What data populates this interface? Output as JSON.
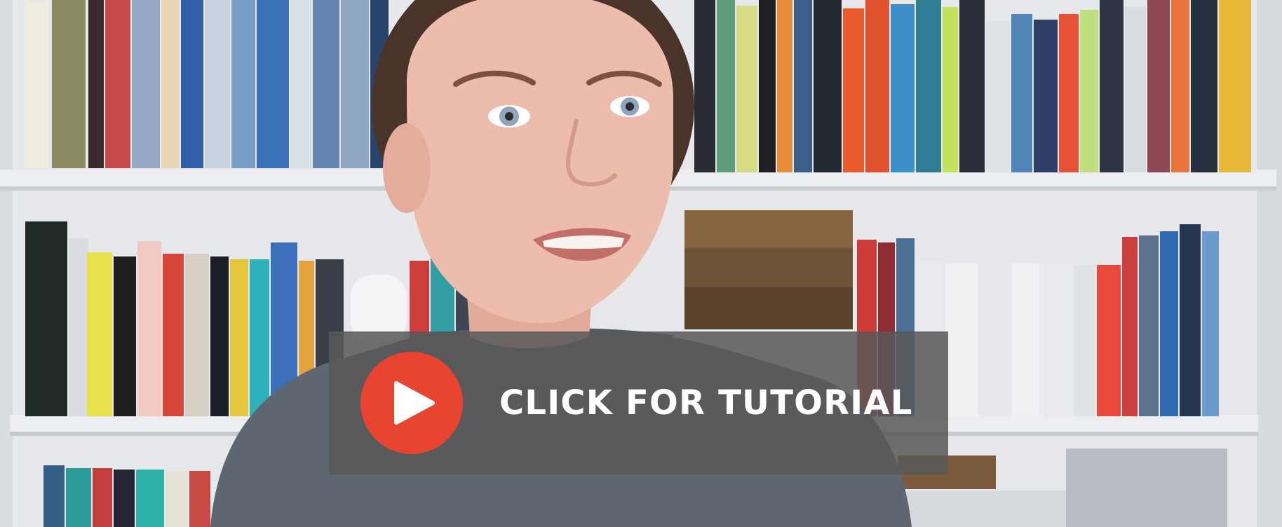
{
  "overlay": {
    "cta_label": "CLICK FOR TUTORIAL",
    "play_icon": "play-icon"
  },
  "colors": {
    "play_button": "#e94430",
    "overlay_bg": "#585858",
    "cta_text": "#ffffff",
    "shelf": "#eceef1",
    "shirt": "#5e6672",
    "skin": "#e8b9a7",
    "hair": "#4a3328"
  }
}
